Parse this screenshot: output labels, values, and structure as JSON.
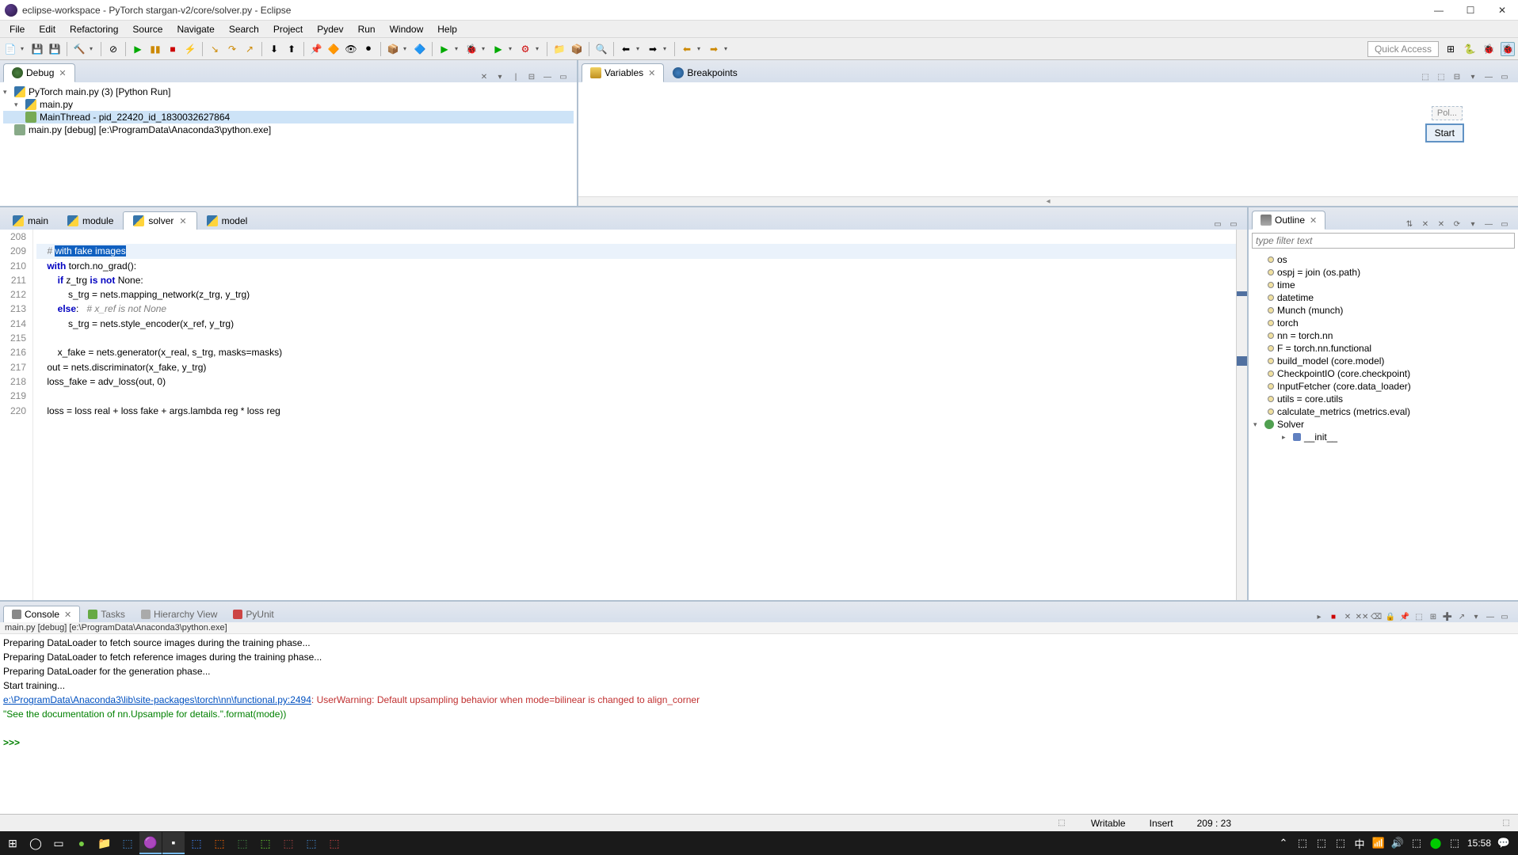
{
  "window": {
    "title": "eclipse-workspace - PyTorch stargan-v2/core/solver.py - Eclipse"
  },
  "menu": [
    "File",
    "Edit",
    "Refactoring",
    "Source",
    "Navigate",
    "Search",
    "Project",
    "Pydev",
    "Run",
    "Window",
    "Help"
  ],
  "quick_access": "Quick Access",
  "debug": {
    "title": "Debug",
    "items": {
      "run": "PyTorch main.py (3) [Python Run]",
      "main": "main.py",
      "thread": "MainThread - pid_22420_id_1830032627864",
      "debug": "main.py [debug] [e:\\ProgramData\\Anaconda3\\python.exe]"
    }
  },
  "vars_panel": {
    "variables": "Variables",
    "breakpoints": "Breakpoints",
    "pol": "Pol...",
    "start": "Start"
  },
  "editor": {
    "tabs": [
      "main",
      "module",
      "solver",
      "model"
    ],
    "lines": {
      "208": "",
      "209_pre": "    # ",
      "209_sel": "with fake images",
      "210": "    with torch.no_grad():",
      "211": "        if z_trg is not None:",
      "212": "            s_trg = nets.mapping_network(z_trg, y_trg)",
      "213_a": "        else:",
      "213_b": "   # x_ref is not None",
      "214": "            s_trg = nets.style_encoder(x_ref, y_trg)",
      "215": "",
      "216": "        x_fake = nets.generator(x_real, s_trg, masks=masks)",
      "217": "    out = nets.discriminator(x_fake, y_trg)",
      "218": "    loss_fake = adv_loss(out, 0)",
      "219": "",
      "220": "    loss = loss real + loss fake + args.lambda reg * loss reg"
    },
    "line_numbers": [
      "208",
      "209",
      "210",
      "211",
      "212",
      "213",
      "214",
      "215",
      "216",
      "217",
      "218",
      "219",
      "220"
    ]
  },
  "outline": {
    "title": "Outline",
    "filter_placeholder": "type filter text",
    "items": [
      "os",
      "ospj = join (os.path)",
      "time",
      "datetime",
      "Munch (munch)",
      "torch",
      "nn = torch.nn",
      "F = torch.nn.functional",
      "build_model (core.model)",
      "CheckpointIO (core.checkpoint)",
      "InputFetcher (core.data_loader)",
      "utils = core.utils",
      "calculate_metrics (metrics.eval)"
    ],
    "class": "Solver",
    "method": "__init__"
  },
  "console": {
    "tabs": [
      "Console",
      "Tasks",
      "Hierarchy View",
      "PyUnit"
    ],
    "label": "main.py [debug] [e:\\ProgramData\\Anaconda3\\python.exe]",
    "lines": {
      "l1": "Preparing DataLoader to fetch source images during the training phase...",
      "l2": "Preparing DataLoader to fetch reference images during the training phase...",
      "l3": "Preparing DataLoader for the generation phase...",
      "l4": "Start training...",
      "l5_link": "e:\\ProgramData\\Anaconda3\\lib\\site-packages\\torch\\nn\\functional.py:2494",
      "l5_warn": ": UserWarning: Default upsampling behavior when mode=bilinear is changed to align_corner",
      "l6": "  \"See the documentation of nn.Upsample for details.\".format(mode))"
    },
    "prompt": ">>> "
  },
  "statusbar": {
    "writable": "Writable",
    "insert": "Insert",
    "pos": "209 : 23"
  },
  "tray": {
    "time": "15:58"
  }
}
